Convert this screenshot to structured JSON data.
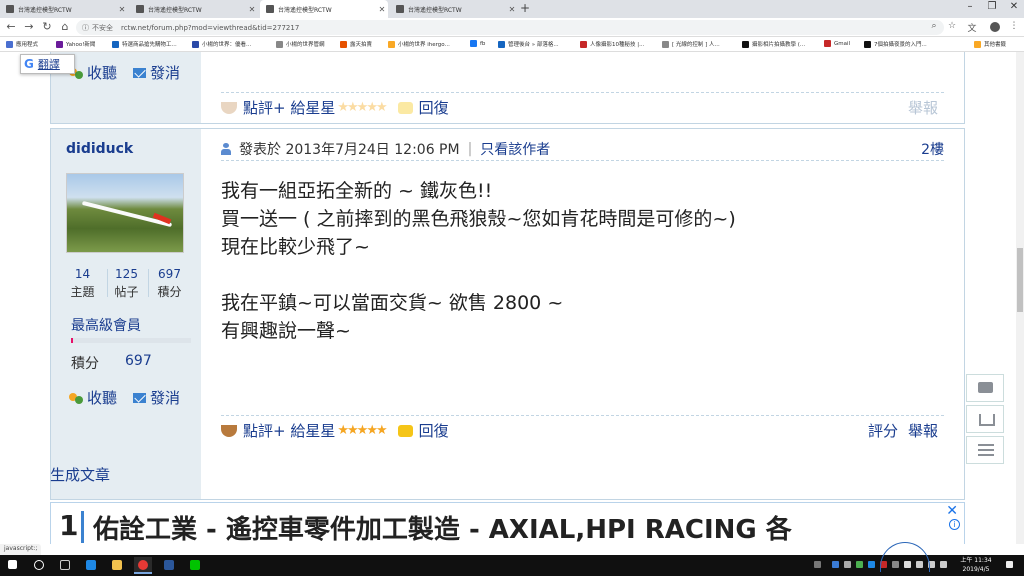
{
  "browser": {
    "tabs": [
      {
        "label": "台灣遙控模型RCTW",
        "active": false
      },
      {
        "label": "台灣遙控模型RCTW",
        "active": false
      },
      {
        "label": "台灣遙控模型RCTW",
        "active": true
      },
      {
        "label": "台灣遙控模型RCTW",
        "active": false
      }
    ],
    "new_tab": "+",
    "url_prefix": "不安全",
    "url": "rctw.net/forum.php?mod=viewthread&tid=277217",
    "bookmarks": [
      {
        "label": "應用程式",
        "color": "#4a6fd0"
      },
      {
        "label": "Yahoo!新聞",
        "color": "#6a1b9a"
      },
      {
        "label": "特選商品搶先購物工...",
        "color": "#1565c0"
      },
      {
        "label": "小楊的世界：優看...",
        "color": "#2b4aa8"
      },
      {
        "label": "小楊的世界管網",
        "color": "#888888"
      },
      {
        "label": "露天拍賣",
        "color": "#e65100"
      },
      {
        "label": "小楊的世界 ihergo...",
        "color": "#f9a825"
      },
      {
        "label": "fb",
        "color": "#1877f2"
      },
      {
        "label": "管理後台 » 部落格...",
        "color": "#1565c0"
      },
      {
        "label": "人像攝影10種秘技 |...",
        "color": "#c62828"
      },
      {
        "label": "[ 光線的控制 ] 人...",
        "color": "#888888"
      },
      {
        "label": "攝影相片拍攝教學 (...",
        "color": "#111111"
      },
      {
        "label": "Gmail",
        "color": "#c62828"
      },
      {
        "label": "7個拍攝夜景的入門...",
        "color": "#111111"
      },
      {
        "label": "其他書籤",
        "color": "#f9a825"
      }
    ]
  },
  "translate": {
    "g": "G",
    "label": "翻譯"
  },
  "post1": {
    "listen": "收聽",
    "message": "發消",
    "rate": "點評",
    "stars_label": "+ 給星星",
    "stars": "★★★★★",
    "reply": "回復",
    "report": "舉報"
  },
  "post2": {
    "username": "dididuck",
    "stats": [
      {
        "num": "14",
        "label": "主題"
      },
      {
        "num": "125",
        "label": "帖子"
      },
      {
        "num": "697",
        "label": "積分"
      }
    ],
    "rank": "最高級會員",
    "rank_progress": 0.02,
    "points_label": "積分",
    "points_value": "697",
    "listen": "收聽",
    "message": "發消",
    "posted_at": "發表於 2013年7月24日 12:06 PM",
    "separator": "|",
    "author_only": "只看該作者",
    "floor": "2樓",
    "body": [
      "我有一組亞拓全新的 ~ 鐵灰色!!",
      "買一送一 ( 之前摔到的黑色飛狼殼~您如肯花時間是可修的~)",
      "現在比較少飛了~",
      "",
      "我在平鎮~可以當面交貨~ 欲售 2800 ~",
      "有興趣說一聲~"
    ],
    "rate": "點評",
    "stars_label": "+ 給星星",
    "stars": "★★★★★",
    "reply": "回復",
    "score": "評分",
    "report": "舉報"
  },
  "related": "生成文章",
  "ad": {
    "num": "1",
    "text": "佑詮工業 - 遙控車零件加工製造 - AXIAL,HPI RACING 各",
    "close": "✕",
    "info": "i"
  },
  "status": "javascript:;",
  "clock": {
    "time": "上午 11:34",
    "date": "2019/4/5"
  }
}
